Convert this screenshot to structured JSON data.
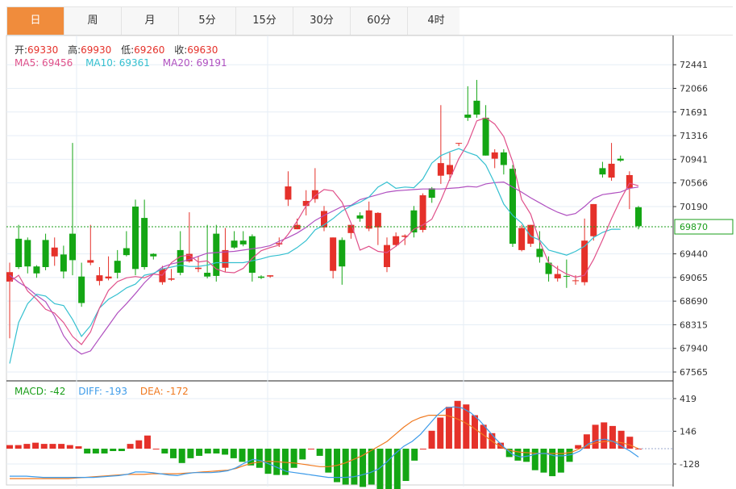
{
  "tabs": [
    {
      "label": "日",
      "active": true
    },
    {
      "label": "周",
      "active": false
    },
    {
      "label": "月",
      "active": false
    },
    {
      "label": "5分",
      "active": false
    },
    {
      "label": "15分",
      "active": false
    },
    {
      "label": "30分",
      "active": false
    },
    {
      "label": "60分",
      "active": false
    },
    {
      "label": "4时",
      "active": false
    }
  ],
  "ohlc": {
    "open_label": "开:",
    "open": "69330",
    "high_label": "高:",
    "high": "69930",
    "low_label": "低:",
    "low": "69260",
    "close_label": "收:",
    "close": "69630"
  },
  "ma_legend": [
    {
      "label": "MA5: 69456",
      "color": "#e0508a"
    },
    {
      "label": "MA10: 69361",
      "color": "#35c0d0"
    },
    {
      "label": "MA20: 69191",
      "color": "#b050c0"
    }
  ],
  "macd_legend": [
    {
      "label": "MACD: -42",
      "color": "#1a9e1a"
    },
    {
      "label": "DIFF: -193",
      "color": "#3d9be9"
    },
    {
      "label": "DEA: -172",
      "color": "#f07a20"
    }
  ],
  "colors": {
    "up": "#e5312a",
    "down": "#14a614",
    "grid": "#e6eef6"
  },
  "chart_data": [
    {
      "type": "candlestick",
      "yticks": [
        72441,
        72066,
        71691,
        71316,
        70941,
        70566,
        70190,
        69440,
        69065,
        68690,
        68315,
        67940,
        67565
      ],
      "ylim": [
        67450,
        72700
      ],
      "last_price": "69870",
      "candles": [
        [
          69000,
          69150,
          68100,
          69300
        ],
        [
          69680,
          69230,
          69200,
          69900
        ],
        [
          69660,
          69240,
          69130,
          69700
        ],
        [
          69240,
          69130,
          69060,
          69260
        ],
        [
          69660,
          69230,
          69180,
          69760
        ],
        [
          69400,
          69540,
          69250,
          69700
        ],
        [
          69430,
          69160,
          69050,
          69570
        ],
        [
          69760,
          69340,
          69100,
          71200
        ],
        [
          69080,
          68660,
          68600,
          69300
        ],
        [
          69300,
          69340,
          69260,
          69900
        ],
        [
          69010,
          69100,
          68940,
          69230
        ],
        [
          69050,
          69080,
          69020,
          69400
        ],
        [
          69330,
          69140,
          69050,
          69500
        ],
        [
          69530,
          69420,
          69400,
          69800
        ],
        [
          70190,
          69200,
          69100,
          70300
        ],
        [
          70010,
          69230,
          69190,
          70300
        ],
        [
          69440,
          69400,
          69350,
          69450
        ],
        [
          68990,
          69200,
          68950,
          69250
        ],
        [
          69030,
          69050,
          69010,
          69200
        ],
        [
          69500,
          69140,
          69100,
          69800
        ],
        [
          69320,
          69440,
          69300,
          70100
        ],
        [
          69200,
          69220,
          69150,
          69400
        ],
        [
          69140,
          69080,
          69050,
          69900
        ],
        [
          69760,
          69090,
          69000,
          69900
        ],
        [
          69220,
          69500,
          69150,
          69850
        ],
        [
          69650,
          69540,
          69520,
          69800
        ],
        [
          69650,
          69590,
          69560,
          69800
        ],
        [
          69720,
          69140,
          69000,
          69750
        ],
        [
          69080,
          69060,
          69040,
          69100
        ],
        [
          69080,
          69100,
          69060,
          69100
        ],
        [
          69590,
          69610,
          69550,
          69700
        ],
        [
          70300,
          70510,
          70200,
          70750
        ],
        [
          69830,
          69900,
          69830,
          70000
        ],
        [
          70200,
          70280,
          70050,
          70450
        ],
        [
          70310,
          70450,
          70250,
          70800
        ],
        [
          69860,
          70120,
          69800,
          70200
        ],
        [
          69170,
          69700,
          69050,
          69700
        ],
        [
          69660,
          69240,
          68950,
          69700
        ],
        [
          69770,
          69900,
          69680,
          69900
        ],
        [
          70050,
          70000,
          69950,
          70100
        ],
        [
          69840,
          70130,
          69800,
          70270
        ],
        [
          69860,
          70090,
          69580,
          70100
        ],
        [
          69230,
          69580,
          69150,
          69700
        ],
        [
          69580,
          69720,
          69550,
          69780
        ],
        [
          69710,
          69730,
          69580,
          69750
        ],
        [
          70130,
          69780,
          69700,
          70200
        ],
        [
          69820,
          70370,
          69780,
          70400
        ],
        [
          70480,
          70330,
          70250,
          70500
        ],
        [
          70680,
          70880,
          70550,
          71800
        ],
        [
          70700,
          70850,
          70600,
          71050
        ],
        [
          71200,
          71200,
          71150,
          71200
        ],
        [
          71650,
          71600,
          71550,
          72100
        ],
        [
          71870,
          71650,
          71600,
          72200
        ],
        [
          71600,
          71000,
          71000,
          71800
        ],
        [
          70950,
          71050,
          70800,
          71100
        ],
        [
          71050,
          70850,
          70700,
          71100
        ],
        [
          70790,
          69600,
          69550,
          70850
        ],
        [
          69500,
          69850,
          69480,
          69900
        ],
        [
          69600,
          69900,
          69550,
          69900
        ],
        [
          69520,
          69390,
          69300,
          69800
        ],
        [
          69300,
          69120,
          69000,
          69400
        ],
        [
          69050,
          69120,
          69000,
          69250
        ],
        [
          69090,
          69080,
          68900,
          69350
        ],
        [
          69010,
          69020,
          68950,
          69100
        ],
        [
          68990,
          69650,
          68940,
          70000
        ],
        [
          69720,
          70230,
          69650,
          70230
        ],
        [
          70800,
          70700,
          70650,
          70900
        ],
        [
          70650,
          70870,
          70600,
          71200
        ],
        [
          70950,
          70920,
          70900,
          71000
        ],
        [
          70480,
          70690,
          70150,
          70750
        ],
        [
          70180,
          69880,
          69830,
          70200
        ]
      ],
      "ma5": [
        69000,
        69100,
        68850,
        68720,
        68560,
        68500,
        68350,
        68130,
        68000,
        68200,
        68580,
        68860,
        69000,
        69060,
        69080,
        69060,
        69120,
        69100,
        69300,
        69400,
        69420,
        69310,
        69330,
        69200,
        69150,
        69140,
        69210,
        69370,
        69490,
        69540,
        69580,
        69750,
        69960,
        70200,
        70360,
        70460,
        70440,
        70260,
        69930,
        69500,
        69560,
        69480,
        69460,
        69560,
        69680,
        69830,
        69900,
        69990,
        70290,
        70630,
        70950,
        71190,
        71550,
        71600,
        71500,
        71300,
        70900,
        70300,
        70070,
        69640,
        69300,
        69200,
        69120,
        69070,
        69100,
        69350,
        69660,
        70000,
        70300,
        70560,
        70520
      ],
      "ma10": [
        67700,
        68350,
        68650,
        68800,
        68770,
        68650,
        68620,
        68400,
        68130,
        68300,
        68580,
        68720,
        68800,
        68900,
        68960,
        69100,
        69130,
        69200,
        69230,
        69260,
        69240,
        69240,
        69260,
        69300,
        69300,
        69300,
        69300,
        69330,
        69360,
        69400,
        69420,
        69450,
        69540,
        69650,
        69820,
        69900,
        70000,
        70120,
        70200,
        70260,
        70340,
        70500,
        70580,
        70480,
        70500,
        70490,
        70630,
        70880,
        71000,
        71060,
        71110,
        71050,
        71000,
        70850,
        70560,
        70230,
        70050,
        69930,
        69720,
        69660,
        69500,
        69460,
        69420,
        69480,
        69560,
        69700,
        69780,
        69830,
        69830
      ],
      "ma20": [
        69100,
        68990,
        68900,
        68780,
        68680,
        68450,
        68140,
        67950,
        67850,
        67900,
        68100,
        68300,
        68500,
        68650,
        68810,
        68980,
        69120,
        69230,
        69280,
        69310,
        69350,
        69400,
        69450,
        69460,
        69470,
        69480,
        69500,
        69520,
        69540,
        69570,
        69640,
        69700,
        69770,
        69860,
        69970,
        70050,
        70120,
        70190,
        70210,
        70300,
        70340,
        70380,
        70420,
        70440,
        70450,
        70460,
        70470,
        70470,
        70470,
        70480,
        70490,
        70510,
        70500,
        70550,
        70570,
        70580,
        70500,
        70420,
        70330,
        70250,
        70170,
        70100,
        70050,
        70080,
        70190,
        70320,
        70380,
        70400,
        70420,
        70480,
        70500
      ]
    },
    {
      "type": "bar",
      "yticks": [
        419,
        146,
        -128
      ],
      "ylim": [
        -290,
        520
      ],
      "macd": [
        30,
        30,
        40,
        50,
        40,
        40,
        40,
        30,
        20,
        -40,
        -40,
        -40,
        -20,
        -20,
        40,
        70,
        110,
        0,
        -40,
        -80,
        -120,
        -80,
        -60,
        -40,
        -40,
        -50,
        -80,
        -110,
        -140,
        -160,
        -210,
        -220,
        -220,
        -160,
        -90,
        0,
        -60,
        -200,
        -280,
        -300,
        -300,
        -320,
        -300,
        -350,
        -380,
        -360,
        -270,
        -100,
        0,
        150,
        260,
        350,
        400,
        370,
        280,
        200,
        130,
        50,
        -70,
        -100,
        -110,
        -180,
        -200,
        -230,
        -200,
        -110,
        30,
        120,
        200,
        220,
        190,
        150,
        100,
        0
      ],
      "diff": [
        -230,
        -230,
        -230,
        -235,
        -240,
        -240,
        -240,
        -240,
        -240,
        -240,
        -240,
        -235,
        -230,
        -225,
        -215,
        -195,
        -195,
        -200,
        -210,
        -220,
        -225,
        -210,
        -200,
        -200,
        -200,
        -195,
        -185,
        -160,
        -120,
        -90,
        -100,
        -130,
        -160,
        -190,
        -200,
        -210,
        -220,
        -230,
        -240,
        -240,
        -240,
        -235,
        -220,
        -200,
        -170,
        -110,
        -40,
        20,
        60,
        120,
        200,
        280,
        340,
        350,
        340,
        300,
        240,
        160,
        80,
        10,
        -50,
        -70,
        -60,
        -40,
        -40,
        -60,
        -60,
        -50,
        -20,
        40,
        70,
        80,
        60,
        20,
        -20,
        -70
      ],
      "dea": [
        -250,
        -250,
        -250,
        -250,
        -250,
        -250,
        -250,
        -250,
        -245,
        -240,
        -235,
        -230,
        -225,
        -220,
        -215,
        -215,
        -215,
        -210,
        -210,
        -210,
        -210,
        -205,
        -200,
        -195,
        -190,
        -185,
        -180,
        -165,
        -140,
        -120,
        -110,
        -105,
        -110,
        -115,
        -120,
        -130,
        -140,
        -150,
        -150,
        -140,
        -120,
        -90,
        -60,
        -20,
        20,
        60,
        120,
        180,
        230,
        260,
        280,
        280,
        280,
        260,
        230,
        190,
        140,
        90,
        40,
        0,
        -20,
        -30,
        -35,
        -40,
        -40,
        -40,
        -40,
        -30,
        0,
        30,
        50,
        60,
        60,
        50,
        30,
        0
      ]
    }
  ]
}
